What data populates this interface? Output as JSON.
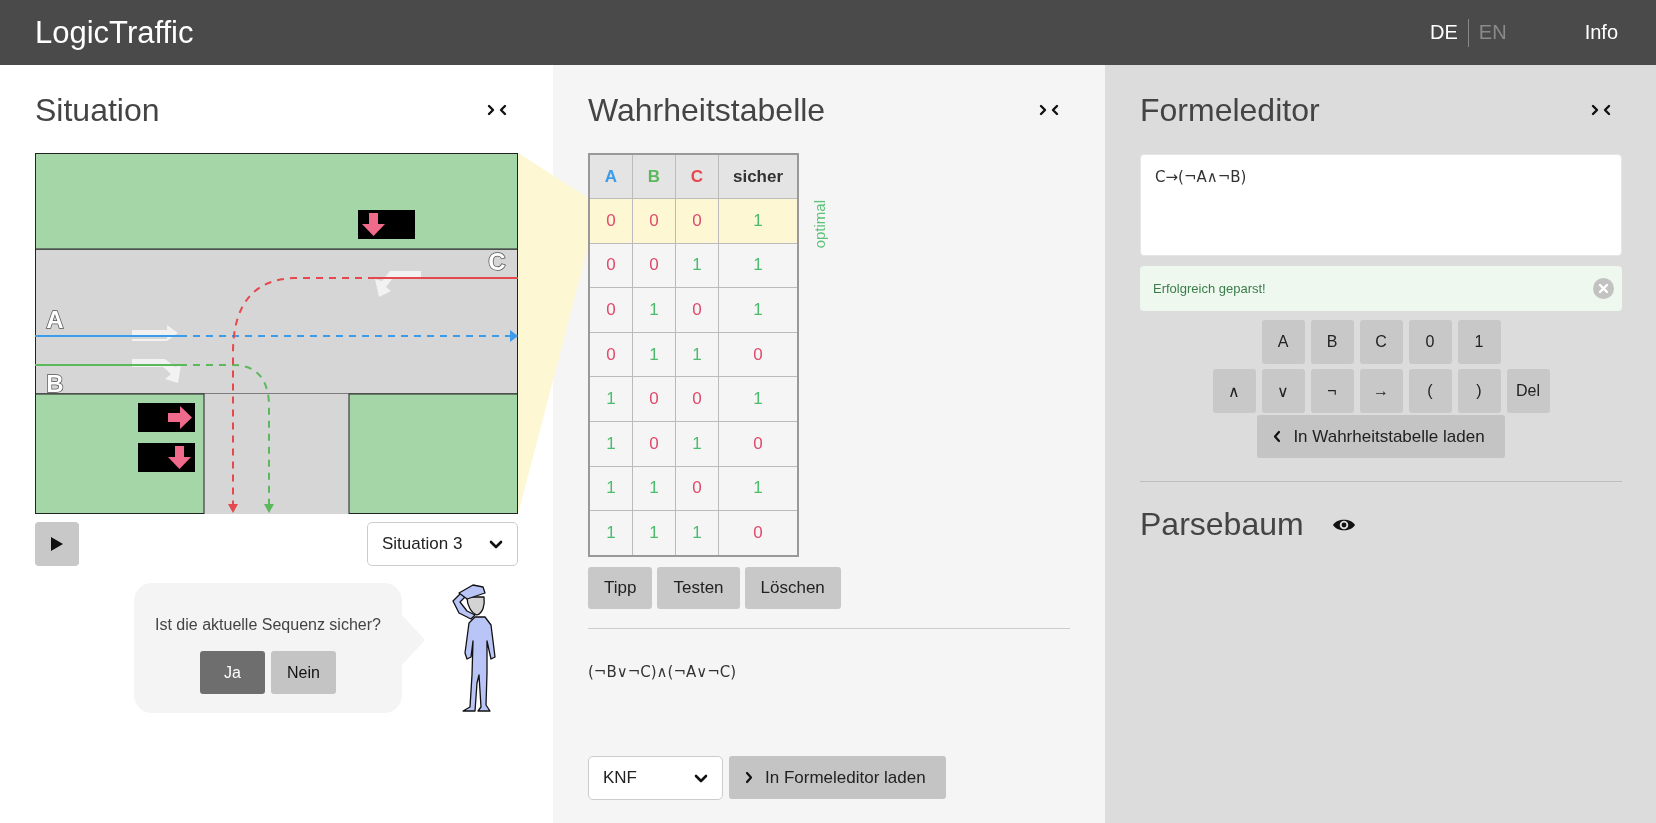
{
  "header": {
    "title": "LogicTraffic",
    "languages": [
      {
        "label": "DE",
        "selected": true
      },
      {
        "label": "EN",
        "selected": false
      }
    ],
    "info": "Info"
  },
  "situation": {
    "title": "Situation",
    "lanes": [
      {
        "label": "A",
        "color": "#3d9be9"
      },
      {
        "label": "B",
        "color": "#5cb85c"
      },
      {
        "label": "C",
        "color": "#e5484d"
      }
    ],
    "signals": [
      {
        "kind": "down"
      },
      {
        "kind": "right"
      },
      {
        "kind": "down"
      }
    ],
    "selector": "Situation 3",
    "question": {
      "text": "Ist die aktuelle Sequenz sicher?",
      "answers": [
        {
          "label": "Ja",
          "selected": true
        },
        {
          "label": "Nein",
          "selected": false
        }
      ]
    }
  },
  "truth_table": {
    "title": "Wahrheitstabelle",
    "columns": [
      {
        "label": "A",
        "color": "#3d9be9"
      },
      {
        "label": "B",
        "color": "#5cb85c"
      },
      {
        "label": "C",
        "color": "#e5484d"
      },
      {
        "label": "sicher",
        "color": "#333333"
      }
    ],
    "rows": [
      {
        "values": [
          "0",
          "0",
          "0",
          "1"
        ],
        "selected": true
      },
      {
        "values": [
          "0",
          "0",
          "1",
          "1"
        ],
        "selected": false
      },
      {
        "values": [
          "0",
          "1",
          "0",
          "1"
        ],
        "selected": false
      },
      {
        "values": [
          "0",
          "1",
          "1",
          "0"
        ],
        "selected": false
      },
      {
        "values": [
          "1",
          "0",
          "0",
          "1"
        ],
        "selected": false
      },
      {
        "values": [
          "1",
          "0",
          "1",
          "0"
        ],
        "selected": false
      },
      {
        "values": [
          "1",
          "1",
          "0",
          "1"
        ],
        "selected": false
      },
      {
        "values": [
          "1",
          "1",
          "1",
          "0"
        ],
        "selected": false
      }
    ],
    "note": "optimal",
    "buttons": [
      "Tipp",
      "Testen",
      "Löschen"
    ],
    "formula": "(¬B∨¬C)∧(¬A∨¬C)",
    "form_select": "KNF",
    "load_button": "In Formeleditor laden"
  },
  "formula_editor": {
    "title": "Formeleditor",
    "value": "C→(¬A∧¬B)",
    "alert": "Erfolgreich geparst!",
    "keypad_rows": [
      {
        "keys": [
          "A",
          "B",
          "C",
          "0",
          "1"
        ]
      },
      {
        "keys": [
          "∧",
          "∨",
          "¬",
          "→",
          "(",
          ")",
          "Del"
        ]
      }
    ],
    "load_button": "In Wahrheitstabelle laden"
  },
  "parse_tree": {
    "title": "Parsebaum"
  }
}
